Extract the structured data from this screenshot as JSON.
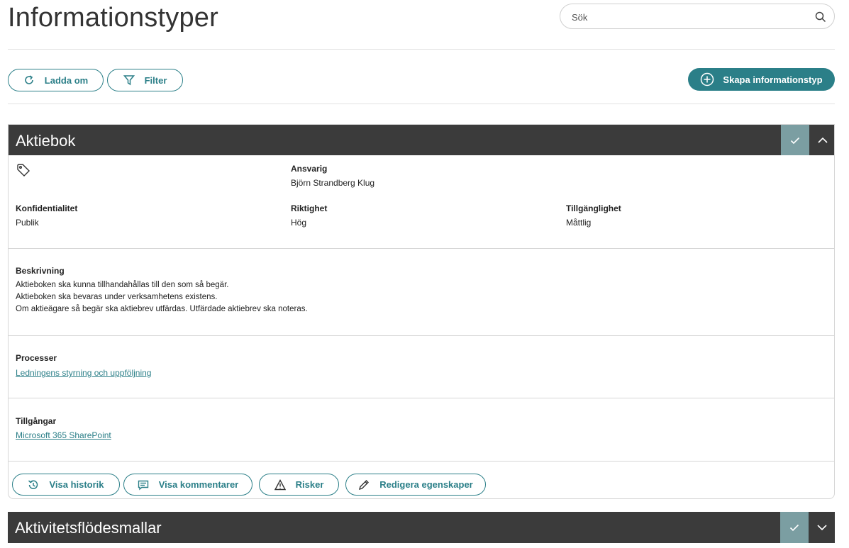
{
  "page": {
    "title": "Informationstyper"
  },
  "search": {
    "placeholder": "Sök"
  },
  "toolbar": {
    "reload_label": "Ladda om",
    "filter_label": "Filter",
    "create_label": "Skapa informationstyp"
  },
  "colors": {
    "accent": "#2b7f88",
    "header_bg": "#3b3b3b",
    "check_bg": "#7b9ea2"
  },
  "card": {
    "title": "Aktiebok",
    "responsible_label": "Ansvarig",
    "responsible_value": "Björn Strandberg Klug",
    "confidentiality_label": "Konfidentialitet",
    "confidentiality_value": "Publik",
    "integrity_label": "Riktighet",
    "integrity_value": "Hög",
    "availability_label": "Tillgänglighet",
    "availability_value": "Måttlig",
    "description_label": "Beskrivning",
    "description_lines": [
      "Aktieboken ska kunna tillhandahållas till den som så begär.",
      "Aktieboken ska bevaras under verksamhetens existens.",
      "Om aktieägare så begär ska aktiebrev utfärdas. Utfärdade aktiebrev ska noteras."
    ],
    "processes_label": "Processer",
    "process_link": "Ledningens styrning och uppföljning",
    "assets_label": "Tillgångar",
    "asset_link": "Microsoft 365 SharePoint",
    "actions": {
      "history": "Visa historik",
      "comments": "Visa kommentarer",
      "risks": "Risker",
      "edit": "Redigera egenskaper"
    }
  },
  "card2": {
    "title": "Aktivitetsflödesmallar"
  },
  "icons": [
    "search-icon",
    "reload-icon",
    "filter-icon",
    "plus-circle-icon",
    "check-icon",
    "chevron-up-icon",
    "chevron-down-icon",
    "tag-icon",
    "history-icon",
    "comment-icon",
    "warning-icon",
    "pencil-icon"
  ]
}
